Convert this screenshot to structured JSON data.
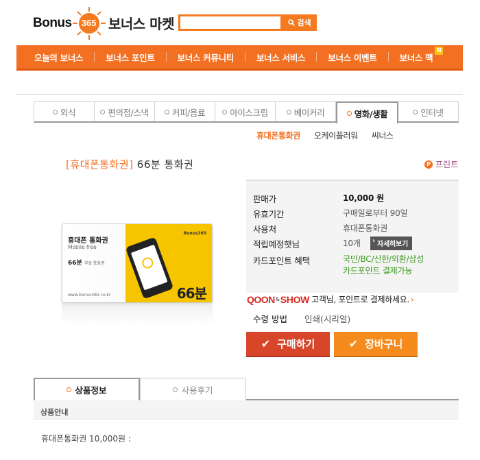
{
  "header": {
    "logo_text": "Bonus",
    "logo_num": "365",
    "site_title": "보너스 마켓",
    "search_value": "",
    "search_button": "검색"
  },
  "nav": [
    {
      "label": "오늘의 보너스"
    },
    {
      "label": "보너스 포인트"
    },
    {
      "label": "보너스 커뮤니티"
    },
    {
      "label": "보너스 서비스"
    },
    {
      "label": "보너스 이벤트"
    },
    {
      "label": "보너스 팩",
      "badge": "N"
    }
  ],
  "categories": [
    {
      "label": "외식"
    },
    {
      "label": "편의점/스낵"
    },
    {
      "label": "커피/음료"
    },
    {
      "label": "아이스크림"
    },
    {
      "label": "베이커리"
    },
    {
      "label": "영화/생활",
      "active": true
    },
    {
      "label": "인터넷"
    }
  ],
  "sub_tabs": [
    {
      "label": "휴대폰통화권",
      "active": true
    },
    {
      "label": "오케이플러워"
    },
    {
      "label": "씨너스"
    }
  ],
  "product": {
    "title_bracket": "[휴대폰통화권]",
    "title_name": " 66분 통화권",
    "print_label": "프린트",
    "card": {
      "title": "휴대폰 통화권",
      "subtitle": "Mobile free",
      "amount": "66분",
      "amount_note": "무료 통화권",
      "url": "www.bonus365.co.kr",
      "big": "66분",
      "brand": "Bonus365"
    },
    "info": {
      "price_label": "판매가",
      "price_value": "10,000 원",
      "validity_label": "유효기간",
      "validity_value": "구매일로부터 90일",
      "usage_label": "사용처",
      "usage_value": "휴대폰통화권",
      "points_label": "적립예정햇님",
      "points_value": "10개",
      "detail_button": "자세히보기",
      "card_label": "카드포인트 혜택",
      "card_value_1": "국민/BC/신한/외환/삼성",
      "card_value_2": "카드포인트 결제가능"
    },
    "qoon": {
      "brand_1": "QOON",
      "amp": "&",
      "brand_2": "SHOW",
      "text": "고객님, 포인트로 결제하세요."
    },
    "receive_label": "수령 방법",
    "receive_value": "인쇄(시리얼)",
    "buy_button": "구매하기",
    "cart_button": "장바구니"
  },
  "bottom_tabs": [
    {
      "label": "상품정보",
      "active": true
    },
    {
      "label": "사용후기"
    }
  ],
  "guide_title": "상품안내",
  "description": "휴대폰통화권 10,000원 :",
  "colors": {
    "accent": "#f36f21",
    "buy": "#d8462a",
    "cart": "#f58b1d",
    "green": "#3a9a1e"
  }
}
